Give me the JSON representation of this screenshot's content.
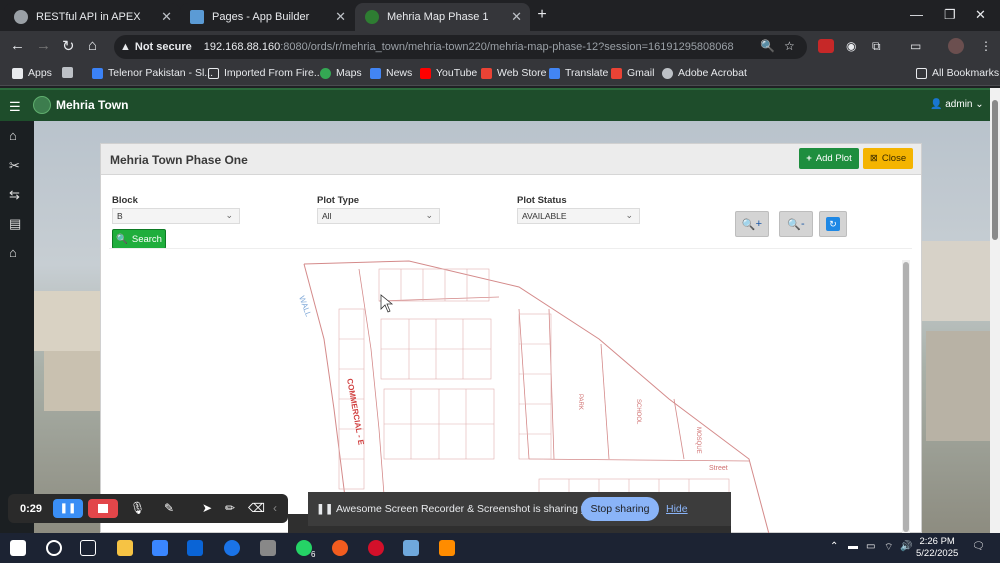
{
  "browser": {
    "tabs": [
      {
        "title": "RESTful API in APEX",
        "active": false
      },
      {
        "title": "Pages - App Builder",
        "active": false
      },
      {
        "title": "Mehria Map Phase 1",
        "active": true
      }
    ],
    "new_tab": "+",
    "security_label": "Not secure",
    "url_host": "192.168.88.160",
    "url_rest": ":8080/ords/r/mehria_town/mehria-town220/mehria-map-phase-12?session=16191295808068",
    "bookmarks": [
      "Apps",
      "Telenor Pakistan - Sl...",
      "Imported From Fire...",
      "Maps",
      "News",
      "YouTube",
      "Web Store",
      "Translate",
      "Gmail",
      "Adobe Acrobat"
    ],
    "all_bookmarks": "All Bookmarks"
  },
  "app": {
    "title": "Mehria Town",
    "user": "admin"
  },
  "region": {
    "title": "Mehria Town Phase One",
    "add_plot_label": "Add Plot",
    "close_label": "Close",
    "filters": {
      "block_label": "Block",
      "block_value": "B",
      "plot_type_label": "Plot Type",
      "plot_type_value": "All",
      "plot_status_label": "Plot Status",
      "plot_status_value": "AVAILABLE"
    },
    "search_label": "Search",
    "zoom_in_label": "+",
    "zoom_out_label": "-",
    "map_labels": {
      "wall": "WALL",
      "commercial": "COMMERCIAL - E",
      "park": "PARK",
      "school": "SCHOOL",
      "mosque": "MOSQUE",
      "street": "Street"
    }
  },
  "recorder": {
    "time": "0:29",
    "share_message": "Awesome Screen Recorder & Screenshot is sharing your screen.",
    "stop_sharing": "Stop sharing",
    "hide": "Hide"
  },
  "taskbar": {
    "time": "2:26 PM",
    "date": "5/22/2025",
    "whatsapp_badge": "6"
  },
  "colors": {
    "app_header": "#1e4d2b",
    "add_plot": "#1e8e3e",
    "close": "#f4b400",
    "search": "#1fae3c",
    "stop_sharing": "#8ab4f8"
  }
}
